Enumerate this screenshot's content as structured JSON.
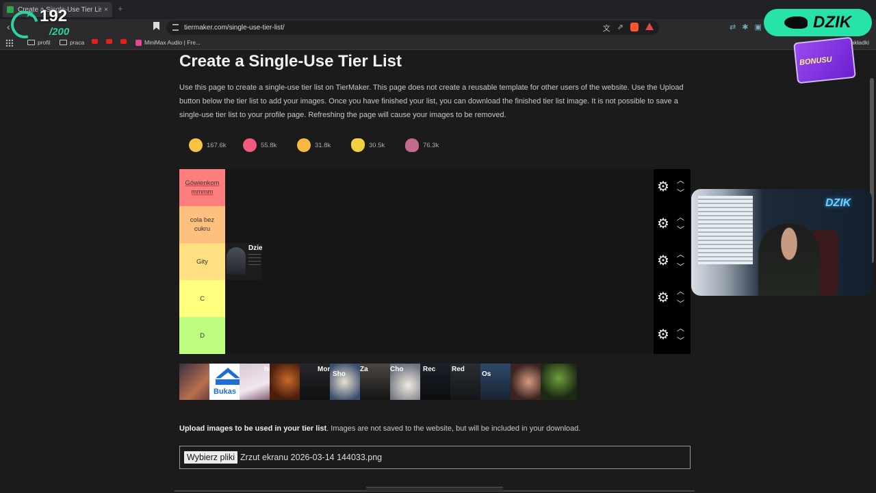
{
  "browser": {
    "tab_title": "Create a Single-Use Tier List (Pr",
    "tab_close": "×",
    "new_tab": "+",
    "url": "tiermaker.com/single-use-tier-list/",
    "bookmarks": [
      {
        "label": "profil",
        "icon": "folder-icon"
      },
      {
        "label": "praca",
        "icon": "folder-icon"
      },
      {
        "label": "",
        "icon": "youtube-icon"
      },
      {
        "label": "",
        "icon": "youtube-icon"
      },
      {
        "label": "",
        "icon": "youtube-icon"
      },
      {
        "label": "MiniMax Audio | Fre...",
        "icon": "minimax-icon"
      }
    ],
    "bookmarks_right": "akładki"
  },
  "page": {
    "title": "Create a Single-Use Tier List",
    "description": "Use this page to create a single-use tier list on TierMaker. This page does not create a reusable template for other users of the website. Use the Upload button below the tier list to add your images. Once you have finished your list, you can download the finished tier list image. It is not possible to save a single-use tier list to your profile page. Refreshing the page will cause your images to be removed.",
    "reactions": [
      {
        "emoji": "grin-emoji",
        "count": "167.6k"
      },
      {
        "emoji": "heart-eyes-emoji",
        "count": "55.8k"
      },
      {
        "emoji": "laughing-emoji",
        "count": "31.8k"
      },
      {
        "emoji": "clapping-emoji",
        "count": "30.5k"
      },
      {
        "emoji": "poop-emoji",
        "count": "76.3k"
      }
    ]
  },
  "tiers": [
    {
      "label": "Gówienkommmmm",
      "label_line1": "Gówienkom",
      "label_line2": "mmmm",
      "color": "#ff7f7f"
    },
    {
      "label": "cola bez cukru",
      "label_line1": "cola bez",
      "label_line2": "cukru",
      "color": "#ffbf7f"
    },
    {
      "label": "Gity",
      "label_line1": "Gity",
      "label_line2": "",
      "color": "#ffdf7f"
    },
    {
      "label": "C",
      "label_line1": "C",
      "label_line2": "",
      "color": "#ffff7f"
    },
    {
      "label": "D",
      "label_line1": "D",
      "label_line2": "",
      "color": "#bfff7f"
    }
  ],
  "tier_items": {
    "gity_item_name": "Dzie"
  },
  "pool": [
    {
      "label": ""
    },
    {
      "label": "Bukas"
    },
    {
      "label": ""
    },
    {
      "label": "hm"
    },
    {
      "label": ""
    },
    {
      "label": "Mort"
    },
    {
      "label": "Sho"
    },
    {
      "label": "Za"
    },
    {
      "label": "Cho"
    },
    {
      "label": "Rec"
    },
    {
      "label": "Red"
    },
    {
      "label": "Os"
    },
    {
      "label": ""
    }
  ],
  "upload": {
    "bold": "Upload images to be used in your tier list",
    "text": ". Images are not saved to the website, but will be included in your download.",
    "button": "Wybierz pliki",
    "filename": "Zrzut ekranu 2026-03-14 144033.png"
  },
  "overlay": {
    "count": "192",
    "total": "/200",
    "brand": "DZIK",
    "promo": "BONUSU",
    "webcam_logo": "DZIK"
  }
}
